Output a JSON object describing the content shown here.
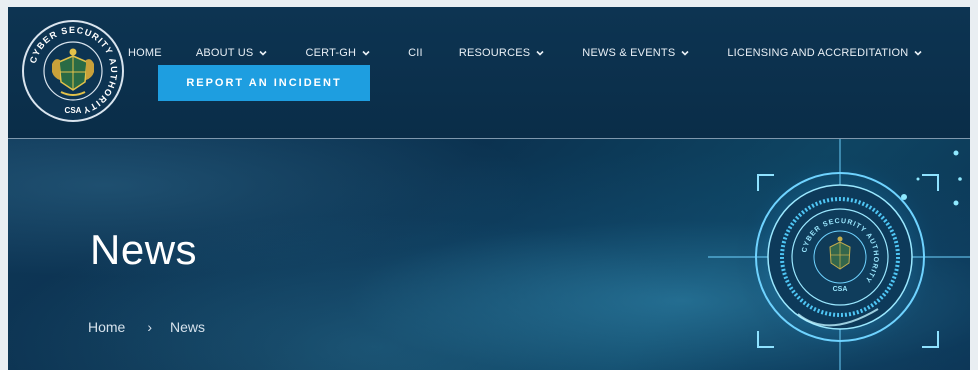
{
  "logo": {
    "ring_text": "CYBER SECURITY AUTHORITY",
    "abbr": "CSA"
  },
  "nav": {
    "items": [
      {
        "label": "HOME",
        "has_dropdown": false
      },
      {
        "label": "ABOUT US",
        "has_dropdown": true
      },
      {
        "label": "CERT-GH",
        "has_dropdown": true
      },
      {
        "label": "CII",
        "has_dropdown": false
      },
      {
        "label": "RESOURCES",
        "has_dropdown": true
      },
      {
        "label": "NEWS & EVENTS",
        "has_dropdown": true
      },
      {
        "label": "LICENSING AND ACCREDITATION",
        "has_dropdown": true
      }
    ],
    "report_button": "REPORT AN INCIDENT"
  },
  "hero": {
    "title": "News",
    "breadcrumb": {
      "home": "Home",
      "separator": "›",
      "current": "News"
    },
    "emblem_ring_text": "CYBER SECURITY AUTHORITY",
    "emblem_abbr": "CSA"
  },
  "colors": {
    "header_bg": "#0d3452",
    "accent": "#1e9ee0",
    "text": "#ffffff"
  }
}
